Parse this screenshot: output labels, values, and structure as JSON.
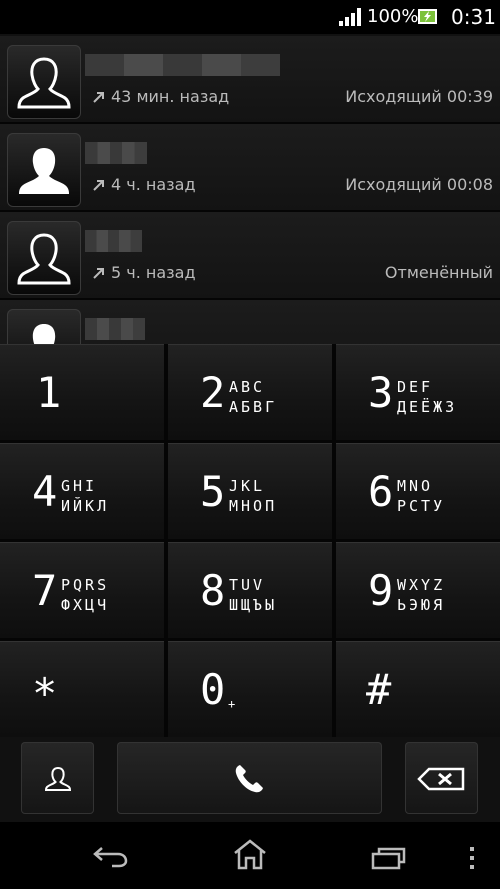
{
  "status_bar": {
    "battery_percent": "100%",
    "clock": "0:31",
    "icons": [
      "signal-icon",
      "battery-charging-icon"
    ]
  },
  "call_log": [
    {
      "avatar": "contact-outline-icon",
      "time_ago": "43 мин. назад",
      "status": "Исходящий 00:39",
      "direction_icon": "outgoing-arrow-icon"
    },
    {
      "avatar": "contact-silhouette-icon",
      "time_ago": "4 ч. назад",
      "status": "Исходящий 00:08",
      "direction_icon": "outgoing-arrow-icon"
    },
    {
      "avatar": "contact-outline-icon",
      "time_ago": "5 ч. назад",
      "status": "Отменённый",
      "direction_icon": "outgoing-arrow-icon"
    },
    {
      "avatar": "contact-silhouette-icon",
      "time_ago": "",
      "status": "",
      "direction_icon": ""
    }
  ],
  "keypad": [
    {
      "digit": "1",
      "lat": "",
      "cyr": ""
    },
    {
      "digit": "2",
      "lat": "ABC",
      "cyr": "АБВГ"
    },
    {
      "digit": "3",
      "lat": "DEF",
      "cyr": "ДЕЁЖЗ"
    },
    {
      "digit": "4",
      "lat": "GHI",
      "cyr": "ИЙКЛ"
    },
    {
      "digit": "5",
      "lat": "JKL",
      "cyr": "МНОП"
    },
    {
      "digit": "6",
      "lat": "MNO",
      "cyr": "РСТУ"
    },
    {
      "digit": "7",
      "lat": "PQRS",
      "cyr": "ФХЦЧ"
    },
    {
      "digit": "8",
      "lat": "TUV",
      "cyr": "ШЩЪЫ"
    },
    {
      "digit": "9",
      "lat": "WXYZ",
      "cyr": "ЬЭЮЯ"
    },
    {
      "digit": "*",
      "lat": "",
      "cyr": ""
    },
    {
      "digit": "0",
      "lat": "+",
      "cyr": ""
    },
    {
      "digit": "#",
      "lat": "",
      "cyr": ""
    }
  ],
  "action_bar": {
    "icons": [
      "contacts-icon",
      "phone-call-icon",
      "backspace-icon"
    ]
  },
  "nav_bar": {
    "icons": [
      "back-icon",
      "home-icon",
      "recent-apps-icon",
      "menu-dots-icon"
    ]
  },
  "colors": {
    "background": "#000000",
    "key_face": "#1a1a1a",
    "text": "#ffffff",
    "secondary_text": "#bbbbbb"
  }
}
